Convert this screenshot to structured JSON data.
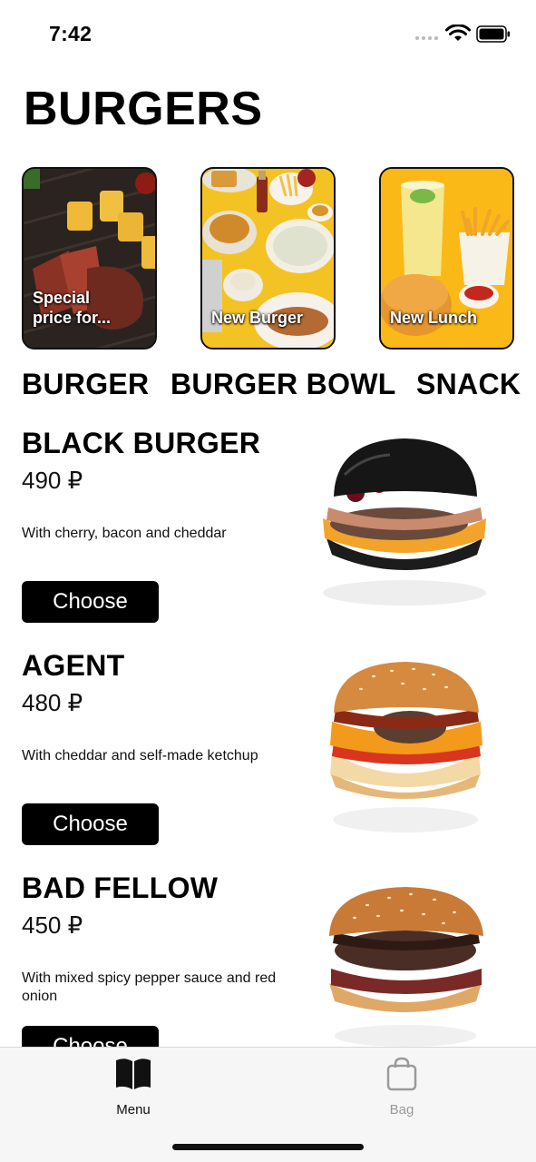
{
  "status_bar": {
    "time": "7:42"
  },
  "page": {
    "title": "BURGERS"
  },
  "stories": [
    {
      "label": "Special price for..."
    },
    {
      "label": "New Burger"
    },
    {
      "label": "New Lunch"
    }
  ],
  "categories": [
    "BURGER",
    "BURGER BOWL",
    "SNACK"
  ],
  "products": [
    {
      "name": "BLACK BURGER",
      "price": "490 ₽",
      "description": "With cherry, bacon and cheddar",
      "button": "Choose"
    },
    {
      "name": "AGENT",
      "price": "480 ₽",
      "description": "With cheddar and self-made ketchup",
      "button": "Choose"
    },
    {
      "name": "BAD FELLOW",
      "price": "450 ₽",
      "description": "With mixed spicy pepper sauce and red onion",
      "button": "Choose"
    }
  ],
  "tab_bar": {
    "items": [
      {
        "label": "Menu",
        "icon": "book-icon",
        "active": true
      },
      {
        "label": "Bag",
        "icon": "bag-icon",
        "active": false
      }
    ]
  }
}
